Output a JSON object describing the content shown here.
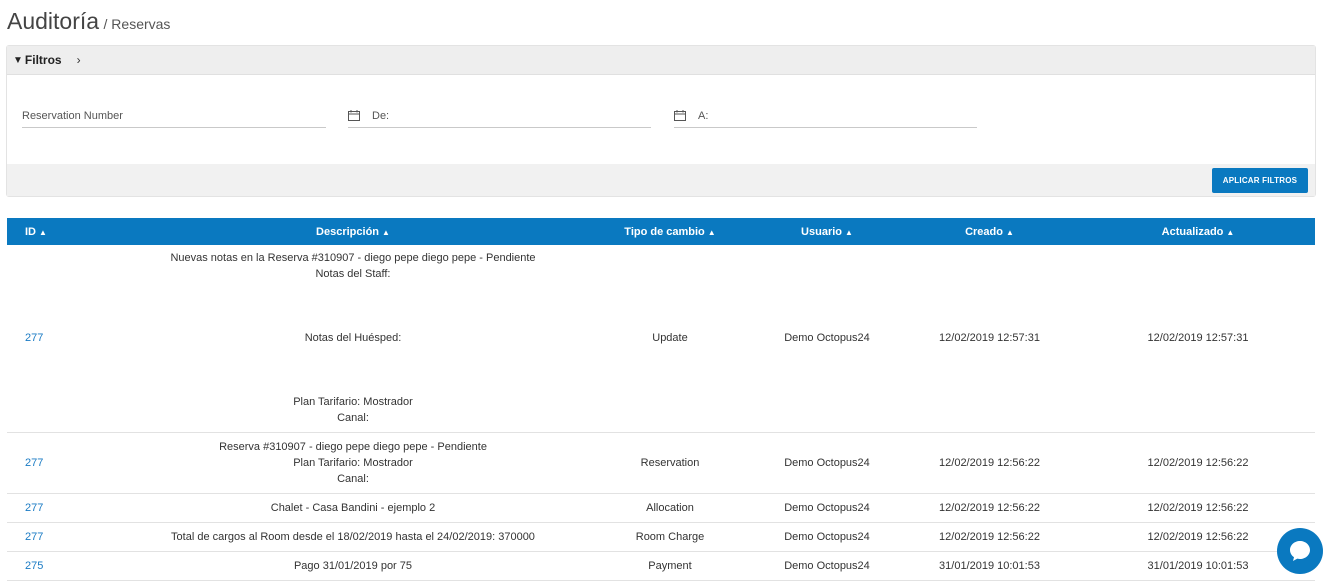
{
  "header": {
    "title": "Auditoría",
    "breadcrumb": "/ Reservas"
  },
  "filters": {
    "heading": "Filtros",
    "reservation_placeholder": "Reservation Number",
    "from_placeholder": "De:",
    "to_placeholder": "A:",
    "apply_label": "APLICAR FILTROS"
  },
  "table": {
    "columns": [
      "ID",
      "Descripción",
      "Tipo de cambio",
      "Usuario",
      "Creado",
      "Actualizado"
    ],
    "rows": [
      {
        "id": "277",
        "desc": [
          "Nuevas notas en la Reserva #310907 - diego pepe diego pepe - Pendiente",
          "Notas del Staff:",
          "",
          "",
          "",
          "Notas del Huésped:",
          "",
          "",
          "",
          "Plan Tarifario: Mostrador",
          "Canal:"
        ],
        "type": "Update",
        "user": "Demo Octopus24",
        "created": "12/02/2019 12:57:31",
        "updated": "12/02/2019 12:57:31"
      },
      {
        "id": "277",
        "desc": [
          "Reserva #310907 - diego pepe diego pepe - Pendiente",
          "Plan Tarifario: Mostrador",
          "Canal:"
        ],
        "type": "Reservation",
        "user": "Demo Octopus24",
        "created": "12/02/2019 12:56:22",
        "updated": "12/02/2019 12:56:22"
      },
      {
        "id": "277",
        "desc": [
          "Chalet - Casa Bandini - ejemplo 2"
        ],
        "type": "Allocation",
        "user": "Demo Octopus24",
        "created": "12/02/2019 12:56:22",
        "updated": "12/02/2019 12:56:22"
      },
      {
        "id": "277",
        "desc": [
          "Total de cargos al Room desde el 18/02/2019 hasta el 24/02/2019: 370000"
        ],
        "type": "Room Charge",
        "user": "Demo Octopus24",
        "created": "12/02/2019 12:56:22",
        "updated": "12/02/2019 12:56:22"
      },
      {
        "id": "275",
        "desc": [
          "Pago 31/01/2019 por 75"
        ],
        "type": "Payment",
        "user": "Demo Octopus24",
        "created": "31/01/2019 10:01:53",
        "updated": "31/01/2019 10:01:53"
      }
    ]
  },
  "colors": {
    "primary": "#0a79c0",
    "link": "#1a7bc4"
  }
}
